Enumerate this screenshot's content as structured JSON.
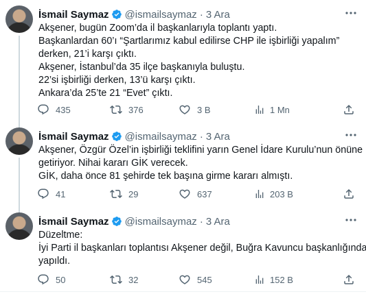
{
  "tweets": [
    {
      "author": "İsmail Saymaz",
      "handle": "@ismailsaymaz",
      "separator": "·",
      "time": "3 Ara",
      "lines": [
        "Akşener, bugün Zoom’da il başkanlarıyla toplantı yaptı.",
        "Başkanlardan 60’ı “Şartlarımız kabul edilirse CHP ile işbirliği yapalım”",
        "derken, 21’i karşı çıktı.",
        "Akşener, İstanbul’da 35 ilçe başkanıyla buluştu.",
        "22’si işbirliği derken, 13’ü karşı çıktı.",
        "Ankara’da 25’te 21 “Evet” çıktı."
      ],
      "replies": "435",
      "reposts": "376",
      "likes": "3 B",
      "views": "1 Mn"
    },
    {
      "author": "İsmail Saymaz",
      "handle": "@ismailsaymaz",
      "separator": "·",
      "time": "3 Ara",
      "lines": [
        "Akşener, Özgür Özel’in işbirliği teklifini yarın Genel İdare Kurulu’nun önüne",
        "getiriyor. Nihai kararı GİK verecek.",
        "GİK, daha önce 81 şehirde tek başına  girme kararı almıştı."
      ],
      "replies": "41",
      "reposts": "29",
      "likes": "637",
      "views": "203 B"
    },
    {
      "author": "İsmail Saymaz",
      "handle": "@ismailsaymaz",
      "separator": "·",
      "time": "3 Ara",
      "lines": [
        "Düzeltme:",
        "İyi Parti il başkanları toplantısı Akşener değil, Buğra Kavuncu başkanlığında",
        "yapıldı."
      ],
      "replies": "50",
      "reposts": "32",
      "likes": "545",
      "views": "152 B"
    }
  ],
  "colors": {
    "text": "#0f1419",
    "secondary": "#536471",
    "verified": "#1d9bf0",
    "thread_line": "#cfd9de"
  },
  "icons": [
    "more-icon",
    "verified-badge-icon",
    "reply-icon",
    "repost-icon",
    "like-icon",
    "views-icon",
    "share-icon"
  ]
}
